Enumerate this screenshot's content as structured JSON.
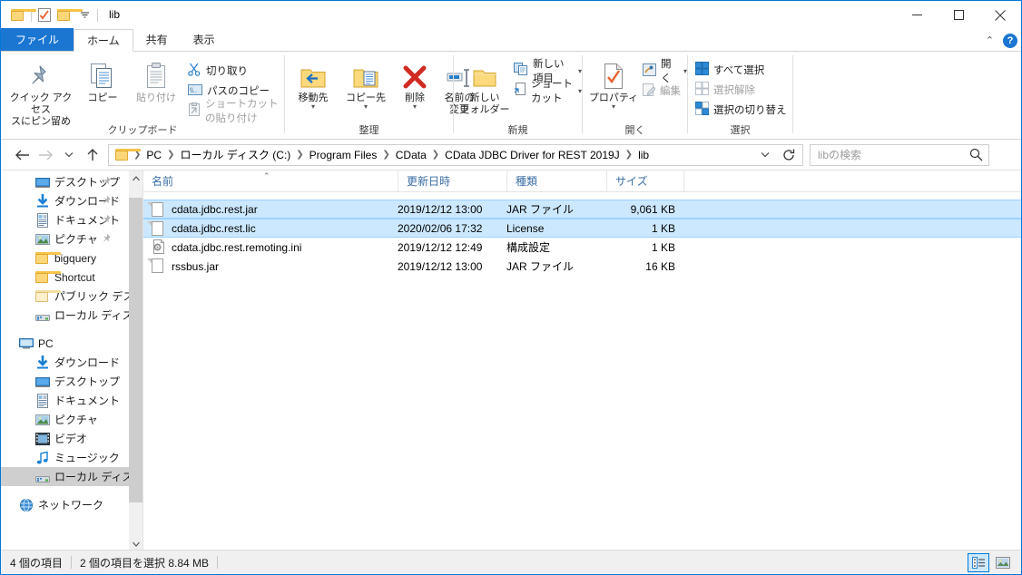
{
  "window": {
    "title": "lib",
    "quick_access": [
      {
        "name": "folder-icon",
        "label": "folder"
      },
      {
        "name": "properties-icon",
        "label": "properties"
      },
      {
        "name": "new-folder-icon",
        "label": "new folder"
      },
      {
        "name": "chevron-down-icon",
        "label": "customize"
      }
    ],
    "controls": {
      "minimize": "minimize",
      "maximize": "maximize",
      "close": "close"
    }
  },
  "tabs": [
    {
      "label": "ファイル",
      "kind": "file"
    },
    {
      "label": "ホーム",
      "kind": "active"
    },
    {
      "label": "共有",
      "kind": "normal"
    },
    {
      "label": "表示",
      "kind": "normal"
    }
  ],
  "ribbon": {
    "collapse_tooltip": "リボンを折りたたむ",
    "help_label": "?",
    "groups": [
      {
        "label": "クリップボード",
        "big_buttons": [
          {
            "label": "クイック アクセス\nスにピン留め",
            "label_line1": "クイック アクセス",
            "label_line2": "スにピン留め",
            "icon": "pin-icon",
            "disabled": false
          },
          {
            "label": "コピー",
            "icon": "copy-icon",
            "disabled": false
          },
          {
            "label": "貼り付け",
            "icon": "paste-icon",
            "disabled": true
          }
        ],
        "small_buttons": [
          {
            "label": "切り取り",
            "icon": "scissors-icon",
            "disabled": false
          },
          {
            "label": "パスのコピー",
            "icon": "copy-path-icon",
            "disabled": false
          },
          {
            "label": "ショートカットの貼り付け",
            "icon": "paste-shortcut-icon",
            "disabled": true
          }
        ]
      },
      {
        "label": "整理",
        "big_buttons": [
          {
            "label": "移動先",
            "icon": "move-to-icon",
            "has_caret": true
          },
          {
            "label": "コピー先",
            "icon": "copy-to-icon",
            "has_caret": true
          },
          {
            "label": "削除",
            "icon": "delete-icon",
            "has_caret": true
          },
          {
            "label_line1": "名前の",
            "label_line2": "変更",
            "icon": "rename-icon",
            "has_caret": false
          }
        ],
        "small_buttons": []
      },
      {
        "label": "新規",
        "big_buttons": [
          {
            "label_line1": "新しい",
            "label_line2": "フォルダー",
            "icon": "new-folder-icon"
          }
        ],
        "small_buttons": [
          {
            "label": "新しい項目",
            "icon": "new-item-icon",
            "has_caret": true
          },
          {
            "label": "ショートカット",
            "icon": "shortcut-icon",
            "has_caret": true
          }
        ]
      },
      {
        "label": "開く",
        "big_buttons": [
          {
            "label": "プロパティ",
            "icon": "properties-icon",
            "has_caret": true
          }
        ],
        "small_buttons": [
          {
            "label": "開く",
            "icon": "open-icon",
            "has_caret": true,
            "disabled": false
          },
          {
            "label": "編集",
            "icon": "edit-icon",
            "disabled": true
          }
        ]
      },
      {
        "label": "選択",
        "big_buttons": [],
        "small_buttons": [
          {
            "label": "すべて選択",
            "icon": "select-all-icon"
          },
          {
            "label": "選択解除",
            "icon": "select-none-icon",
            "disabled": true
          },
          {
            "label": "選択の切り替え",
            "icon": "invert-selection-icon"
          }
        ]
      }
    ]
  },
  "addressbar": {
    "back": "戻る",
    "forward": "進む",
    "recent": "最近表示した場所",
    "up": "上へ",
    "breadcrumbs": [
      "PC",
      "ローカル ディスク (C:)",
      "Program Files",
      "CData",
      "CData JDBC Driver for REST 2019J",
      "lib"
    ],
    "dropdown": "履歴",
    "refresh": "更新"
  },
  "search": {
    "placeholder": "libの検索",
    "value": "",
    "icon": "search-icon"
  },
  "navpane": {
    "items": [
      {
        "label": "デスクトップ",
        "icon": "desktop-icon",
        "pinned": true,
        "indent": 1,
        "selected": false
      },
      {
        "label": "ダウンロード",
        "icon": "download-icon",
        "pinned": true,
        "indent": 1,
        "selected": false
      },
      {
        "label": "ドキュメント",
        "icon": "documents-icon",
        "pinned": true,
        "indent": 1,
        "selected": false
      },
      {
        "label": "ピクチャ",
        "icon": "pictures-icon",
        "pinned": true,
        "indent": 1,
        "selected": false
      },
      {
        "label": "bigquery",
        "icon": "folder-icon",
        "pinned": false,
        "indent": 1,
        "selected": false
      },
      {
        "label": "Shortcut",
        "icon": "folder-icon",
        "pinned": false,
        "indent": 1,
        "selected": false
      },
      {
        "label": "パブリック デスクトッ",
        "icon": "folder-pale-icon",
        "pinned": false,
        "indent": 1,
        "selected": false
      },
      {
        "label": "ローカル ディスク (C",
        "icon": "drive-icon",
        "pinned": false,
        "indent": 1,
        "selected": false
      },
      {
        "label": "PC",
        "icon": "pc-icon",
        "pinned": false,
        "indent": 0,
        "selected": false,
        "gap_before": true
      },
      {
        "label": "ダウンロード",
        "icon": "download-icon",
        "pinned": false,
        "indent": 1,
        "selected": false
      },
      {
        "label": "デスクトップ",
        "icon": "desktop-icon",
        "pinned": false,
        "indent": 1,
        "selected": false
      },
      {
        "label": "ドキュメント",
        "icon": "documents-icon",
        "pinned": false,
        "indent": 1,
        "selected": false
      },
      {
        "label": "ピクチャ",
        "icon": "pictures-icon",
        "pinned": false,
        "indent": 1,
        "selected": false
      },
      {
        "label": "ビデオ",
        "icon": "videos-icon",
        "pinned": false,
        "indent": 1,
        "selected": false
      },
      {
        "label": "ミュージック",
        "icon": "music-icon",
        "pinned": false,
        "indent": 1,
        "selected": false
      },
      {
        "label": "ローカル ディスク (C",
        "icon": "drive-icon",
        "pinned": false,
        "indent": 1,
        "selected": true
      },
      {
        "label": "ネットワーク",
        "icon": "network-icon",
        "pinned": false,
        "indent": 0,
        "selected": false,
        "gap_before": true
      }
    ],
    "scroll": {
      "up": "▲",
      "down": "▼"
    }
  },
  "filelist": {
    "columns": [
      {
        "label": "名前",
        "sorted": true,
        "sort_dir": "asc"
      },
      {
        "label": "更新日時",
        "sorted": false
      },
      {
        "label": "種類",
        "sorted": false
      },
      {
        "label": "サイズ",
        "sorted": false
      }
    ],
    "rows": [
      {
        "name": "cdata.jdbc.rest.jar",
        "date": "2019/12/12 13:00",
        "type": "JAR ファイル",
        "size": "9,061 KB",
        "icon": "file-icon",
        "selected": true,
        "focused": true
      },
      {
        "name": "cdata.jdbc.rest.lic",
        "date": "2020/02/06 17:32",
        "type": "License",
        "size": "1 KB",
        "icon": "file-icon",
        "selected": true,
        "focused": false
      },
      {
        "name": "cdata.jdbc.rest.remoting.ini",
        "date": "2019/12/12 12:49",
        "type": "構成設定",
        "size": "1 KB",
        "icon": "ini-icon",
        "selected": false,
        "focused": false
      },
      {
        "name": "rssbus.jar",
        "date": "2019/12/12 13:00",
        "type": "JAR ファイル",
        "size": "16 KB",
        "icon": "file-icon",
        "selected": false,
        "focused": false
      }
    ]
  },
  "statusbar": {
    "item_count": "4 個の項目",
    "selection": "2 個の項目を選択  8.84 MB",
    "views": [
      {
        "name": "details-view-button",
        "active": true
      },
      {
        "name": "large-icons-view-button",
        "active": false
      }
    ]
  },
  "colors": {
    "accent": "#0078d7",
    "file_tab": "#1b76d2",
    "selection": "#cce8ff",
    "selection_border": "#99d1ff",
    "nav_selected": "#cfcfcf",
    "column_header_text": "#3a6ea5",
    "statusbar_bg": "#f0f0f0"
  }
}
